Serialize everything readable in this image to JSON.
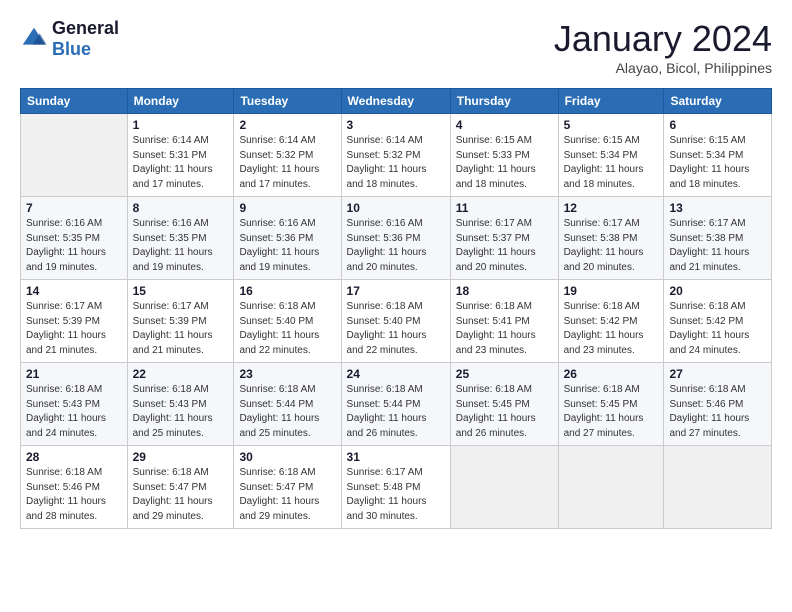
{
  "header": {
    "logo_line1": "General",
    "logo_line2": "Blue",
    "month": "January 2024",
    "location": "Alayao, Bicol, Philippines"
  },
  "weekdays": [
    "Sunday",
    "Monday",
    "Tuesday",
    "Wednesday",
    "Thursday",
    "Friday",
    "Saturday"
  ],
  "weeks": [
    [
      {
        "num": "",
        "info": ""
      },
      {
        "num": "1",
        "info": "Sunrise: 6:14 AM\nSunset: 5:31 PM\nDaylight: 11 hours\nand 17 minutes."
      },
      {
        "num": "2",
        "info": "Sunrise: 6:14 AM\nSunset: 5:32 PM\nDaylight: 11 hours\nand 17 minutes."
      },
      {
        "num": "3",
        "info": "Sunrise: 6:14 AM\nSunset: 5:32 PM\nDaylight: 11 hours\nand 18 minutes."
      },
      {
        "num": "4",
        "info": "Sunrise: 6:15 AM\nSunset: 5:33 PM\nDaylight: 11 hours\nand 18 minutes."
      },
      {
        "num": "5",
        "info": "Sunrise: 6:15 AM\nSunset: 5:34 PM\nDaylight: 11 hours\nand 18 minutes."
      },
      {
        "num": "6",
        "info": "Sunrise: 6:15 AM\nSunset: 5:34 PM\nDaylight: 11 hours\nand 18 minutes."
      }
    ],
    [
      {
        "num": "7",
        "info": "Sunrise: 6:16 AM\nSunset: 5:35 PM\nDaylight: 11 hours\nand 19 minutes."
      },
      {
        "num": "8",
        "info": "Sunrise: 6:16 AM\nSunset: 5:35 PM\nDaylight: 11 hours\nand 19 minutes."
      },
      {
        "num": "9",
        "info": "Sunrise: 6:16 AM\nSunset: 5:36 PM\nDaylight: 11 hours\nand 19 minutes."
      },
      {
        "num": "10",
        "info": "Sunrise: 6:16 AM\nSunset: 5:36 PM\nDaylight: 11 hours\nand 20 minutes."
      },
      {
        "num": "11",
        "info": "Sunrise: 6:17 AM\nSunset: 5:37 PM\nDaylight: 11 hours\nand 20 minutes."
      },
      {
        "num": "12",
        "info": "Sunrise: 6:17 AM\nSunset: 5:38 PM\nDaylight: 11 hours\nand 20 minutes."
      },
      {
        "num": "13",
        "info": "Sunrise: 6:17 AM\nSunset: 5:38 PM\nDaylight: 11 hours\nand 21 minutes."
      }
    ],
    [
      {
        "num": "14",
        "info": "Sunrise: 6:17 AM\nSunset: 5:39 PM\nDaylight: 11 hours\nand 21 minutes."
      },
      {
        "num": "15",
        "info": "Sunrise: 6:17 AM\nSunset: 5:39 PM\nDaylight: 11 hours\nand 21 minutes."
      },
      {
        "num": "16",
        "info": "Sunrise: 6:18 AM\nSunset: 5:40 PM\nDaylight: 11 hours\nand 22 minutes."
      },
      {
        "num": "17",
        "info": "Sunrise: 6:18 AM\nSunset: 5:40 PM\nDaylight: 11 hours\nand 22 minutes."
      },
      {
        "num": "18",
        "info": "Sunrise: 6:18 AM\nSunset: 5:41 PM\nDaylight: 11 hours\nand 23 minutes."
      },
      {
        "num": "19",
        "info": "Sunrise: 6:18 AM\nSunset: 5:42 PM\nDaylight: 11 hours\nand 23 minutes."
      },
      {
        "num": "20",
        "info": "Sunrise: 6:18 AM\nSunset: 5:42 PM\nDaylight: 11 hours\nand 24 minutes."
      }
    ],
    [
      {
        "num": "21",
        "info": "Sunrise: 6:18 AM\nSunset: 5:43 PM\nDaylight: 11 hours\nand 24 minutes."
      },
      {
        "num": "22",
        "info": "Sunrise: 6:18 AM\nSunset: 5:43 PM\nDaylight: 11 hours\nand 25 minutes."
      },
      {
        "num": "23",
        "info": "Sunrise: 6:18 AM\nSunset: 5:44 PM\nDaylight: 11 hours\nand 25 minutes."
      },
      {
        "num": "24",
        "info": "Sunrise: 6:18 AM\nSunset: 5:44 PM\nDaylight: 11 hours\nand 26 minutes."
      },
      {
        "num": "25",
        "info": "Sunrise: 6:18 AM\nSunset: 5:45 PM\nDaylight: 11 hours\nand 26 minutes."
      },
      {
        "num": "26",
        "info": "Sunrise: 6:18 AM\nSunset: 5:45 PM\nDaylight: 11 hours\nand 27 minutes."
      },
      {
        "num": "27",
        "info": "Sunrise: 6:18 AM\nSunset: 5:46 PM\nDaylight: 11 hours\nand 27 minutes."
      }
    ],
    [
      {
        "num": "28",
        "info": "Sunrise: 6:18 AM\nSunset: 5:46 PM\nDaylight: 11 hours\nand 28 minutes."
      },
      {
        "num": "29",
        "info": "Sunrise: 6:18 AM\nSunset: 5:47 PM\nDaylight: 11 hours\nand 29 minutes."
      },
      {
        "num": "30",
        "info": "Sunrise: 6:18 AM\nSunset: 5:47 PM\nDaylight: 11 hours\nand 29 minutes."
      },
      {
        "num": "31",
        "info": "Sunrise: 6:17 AM\nSunset: 5:48 PM\nDaylight: 11 hours\nand 30 minutes."
      },
      {
        "num": "",
        "info": ""
      },
      {
        "num": "",
        "info": ""
      },
      {
        "num": "",
        "info": ""
      }
    ]
  ]
}
